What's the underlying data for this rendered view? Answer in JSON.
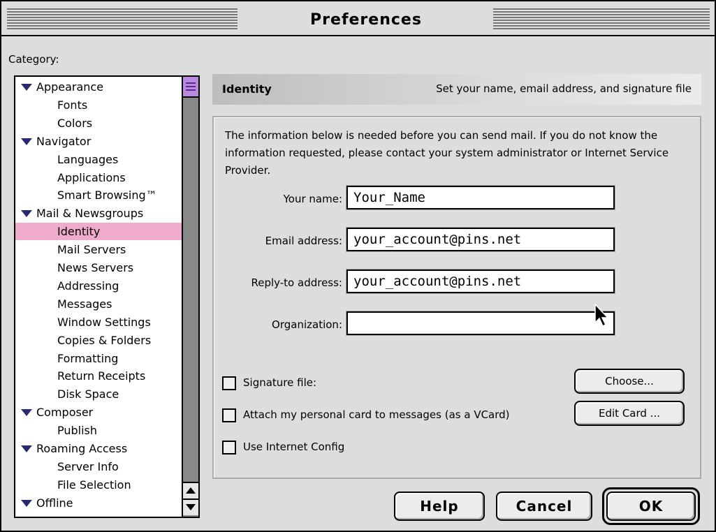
{
  "window": {
    "title": "Preferences"
  },
  "category": {
    "label": "Category:",
    "items": [
      {
        "label": "Appearance",
        "level": "parent"
      },
      {
        "label": "Fonts",
        "level": "child"
      },
      {
        "label": "Colors",
        "level": "child"
      },
      {
        "label": "Navigator",
        "level": "parent"
      },
      {
        "label": "Languages",
        "level": "child"
      },
      {
        "label": "Applications",
        "level": "child"
      },
      {
        "label": "Smart Browsing™",
        "level": "child"
      },
      {
        "label": "Mail & Newsgroups",
        "level": "parent"
      },
      {
        "label": "Identity",
        "level": "child",
        "selected": true
      },
      {
        "label": "Mail Servers",
        "level": "child"
      },
      {
        "label": "News Servers",
        "level": "child"
      },
      {
        "label": "Addressing",
        "level": "child"
      },
      {
        "label": "Messages",
        "level": "child"
      },
      {
        "label": "Window Settings",
        "level": "child"
      },
      {
        "label": "Copies & Folders",
        "level": "child"
      },
      {
        "label": "Formatting",
        "level": "child"
      },
      {
        "label": "Return Receipts",
        "level": "child"
      },
      {
        "label": "Disk Space",
        "level": "child"
      },
      {
        "label": "Composer",
        "level": "parent"
      },
      {
        "label": "Publish",
        "level": "child"
      },
      {
        "label": "Roaming Access",
        "level": "parent"
      },
      {
        "label": "Server Info",
        "level": "child"
      },
      {
        "label": "File Selection",
        "level": "child"
      },
      {
        "label": "Offline",
        "level": "parent"
      }
    ]
  },
  "panel": {
    "title": "Identity",
    "description": "Set your name, email address, and signature file",
    "intro": "The information below is needed before you can send mail. If you do not know the information requested, please contact your system administrator or Internet Service Provider.",
    "fields": {
      "name": {
        "label": "Your name:",
        "value": "Your_Name"
      },
      "email": {
        "label": "Email address:",
        "value": "your_account@pins.net"
      },
      "reply_to": {
        "label": "Reply-to address:",
        "value": "your_account@pins.net"
      },
      "organization": {
        "label": "Organization:",
        "value": ""
      }
    },
    "signature_label": "Signature file:",
    "choose_label": "Choose...",
    "vcard_label": "Attach my personal card to messages (as a VCard)",
    "edit_card_label": "Edit Card ...",
    "internet_config_label": "Use Internet Config"
  },
  "buttons": {
    "help": "Help",
    "cancel": "Cancel",
    "ok": "OK"
  },
  "colors": {
    "selection": "#f0aacb",
    "scroll_thumb": "#b98ae0",
    "disclosure": "#2a2a70"
  }
}
